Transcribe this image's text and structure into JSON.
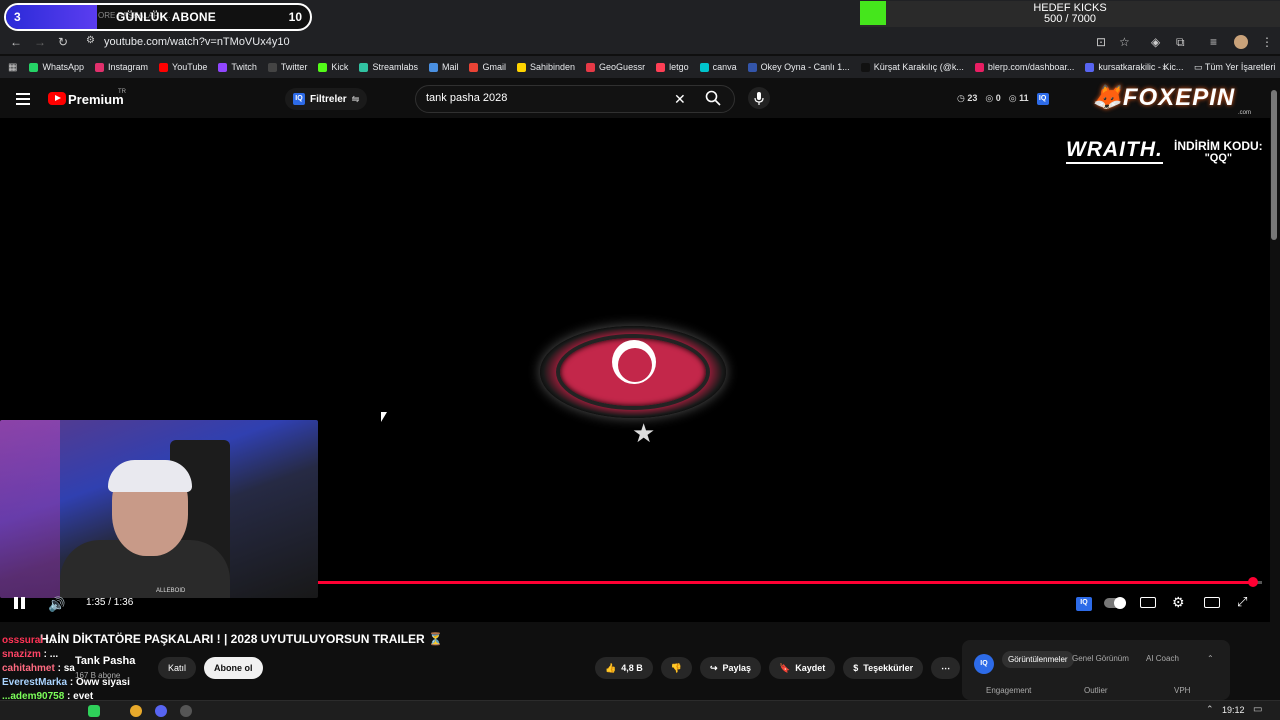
{
  "sub_goal": {
    "title": "GÜNLÜK ABONE",
    "current": "3",
    "target": "10",
    "progress": 0.3,
    "bg_text": "ORE PAŞKALARI ..."
  },
  "kick_goal": {
    "title": "HEDEF KICKS",
    "value": "500 / 7000",
    "progress": 0.071
  },
  "browser": {
    "url": "youtube.com/watch?v=nTMoVUx4y10"
  },
  "bookmarks": [
    {
      "label": "WhatsApp",
      "color": "#25d366"
    },
    {
      "label": "Instagram",
      "color": "#e1306c"
    },
    {
      "label": "YouTube",
      "color": "#ff0000"
    },
    {
      "label": "Twitch",
      "color": "#9146ff"
    },
    {
      "label": "Twitter",
      "color": "#444444"
    },
    {
      "label": "Kick",
      "color": "#53fc18"
    },
    {
      "label": "Streamlabs",
      "color": "#31c3a2"
    },
    {
      "label": "Mail",
      "color": "#4a90e2"
    },
    {
      "label": "Gmail",
      "color": "#ea4335"
    },
    {
      "label": "Sahibinden",
      "color": "#ffd400"
    },
    {
      "label": "GeoGuessr",
      "color": "#e63946"
    },
    {
      "label": "letgo",
      "color": "#ff3f55"
    },
    {
      "label": "canva",
      "color": "#00c4cc"
    },
    {
      "label": "Okey Oyna - Canlı 1...",
      "color": "#3355aa"
    },
    {
      "label": "Kürşat Karakılıç (@k...",
      "color": "#111111"
    },
    {
      "label": "blerp.com/dashboar...",
      "color": "#e91e63"
    },
    {
      "label": "kursatkarakilic - Kic...",
      "color": "#5865f2"
    }
  ],
  "bookmarks_all": "Tüm Yer İşaretleri",
  "youtube": {
    "brand": "Premium",
    "region": "TR",
    "filters_label": "Filtreler",
    "search_value": "tank pasha 2028",
    "stats": {
      "a": "23",
      "b": "0",
      "c": "11"
    }
  },
  "sponsor": {
    "foxepin": "FOXEPIN",
    "foxepin_com": ".com",
    "wraith": "WRAITH.",
    "discount_label": "İNDİRİM KODU:",
    "discount_code": "\"QQ\""
  },
  "player": {
    "time": "1:35 / 1:36",
    "progress": 0.99
  },
  "video": {
    "title": "HAİN DİKTATÖRE PAŞKALARI ! | 2028 UYUTULUYORSUN TRAILER ⏳",
    "channel": "Tank Pasha",
    "subscribers": "167 B abone",
    "join_label": "Katıl",
    "subscribe_label": "Abone ol",
    "likes": "4,8 B",
    "share_label": "Paylaş",
    "save_label": "Kaydet",
    "thanks_label": "Teşekkürler"
  },
  "panel": {
    "tabs": [
      "Görüntülenmeler",
      "Genel Görünüm",
      "AI Coach"
    ],
    "sub": [
      "Engagement",
      "Outlier",
      "VPH"
    ]
  },
  "chat": [
    {
      "user": "osssurai",
      "text": "...",
      "color": "#ff3355"
    },
    {
      "user": "snazizm",
      "text": "...",
      "color": "#ff4466"
    },
    {
      "user": "cahitahmet",
      "text": "sa",
      "color": "#ff6b81"
    },
    {
      "user": "EverestMarka",
      "text": "Oww siyasi",
      "color": "#aad4ff"
    },
    {
      "user": "...adem90758",
      "text": "evet",
      "color": "#7cff5a"
    }
  ],
  "clock": "19:12",
  "webcam_tag": "ALLEBOID"
}
